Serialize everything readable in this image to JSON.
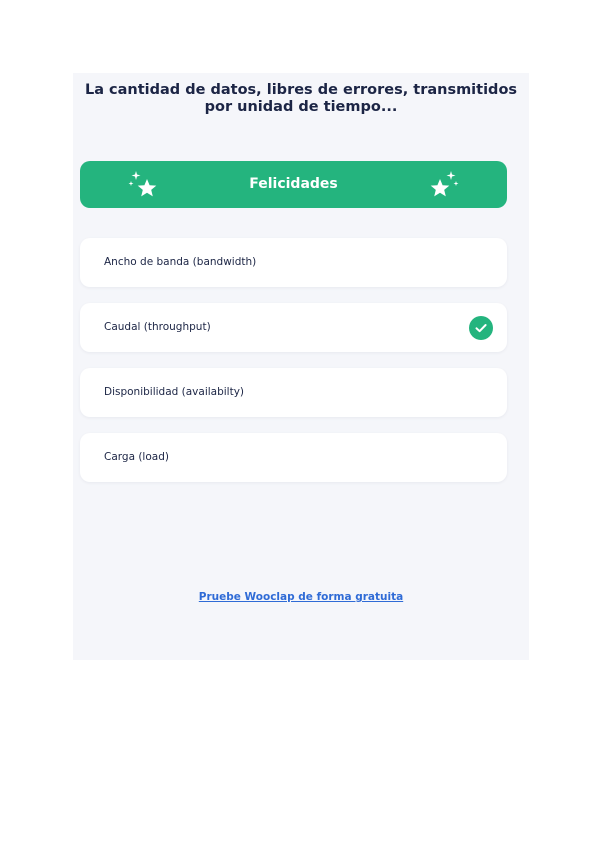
{
  "question": {
    "line1": "La cantidad de datos, libres de errores, transmitidos",
    "line2": "por unidad de tiempo..."
  },
  "result_banner": {
    "label": "Felicidades",
    "color": "#24b47e",
    "icons": [
      "sparkle-star-icon",
      "sparkle-star-icon"
    ]
  },
  "options": [
    {
      "label": "Ancho de banda (bandwidth)",
      "correct": false
    },
    {
      "label": "Caudal (throughput)",
      "correct": true
    },
    {
      "label": "Disponibilidad (availabilty)",
      "correct": false
    },
    {
      "label": "Carga (load)",
      "correct": false
    }
  ],
  "footer": {
    "link_text": "Pruebe Wooclap de forma gratuita"
  },
  "colors": {
    "accent_green": "#24b47e",
    "text_dark": "#1c2545",
    "link_blue": "#2f6bd6",
    "card_background": "#f5f6fa"
  }
}
